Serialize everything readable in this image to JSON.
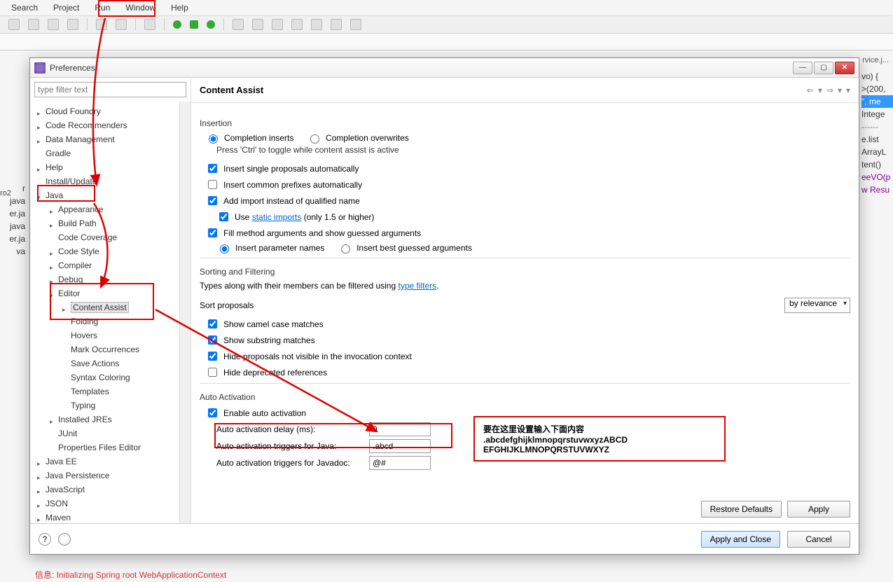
{
  "menubar": {
    "items": [
      "Search",
      "Project",
      "Run",
      "Window",
      "Help"
    ]
  },
  "dialog": {
    "title": "Preferences",
    "page_title": "Content Assist",
    "filter_placeholder": "type filter text"
  },
  "tree": [
    {
      "lvl": 0,
      "tw": "closed",
      "label": "Cloud Foundry"
    },
    {
      "lvl": 0,
      "tw": "closed",
      "label": "Code Recommenders"
    },
    {
      "lvl": 0,
      "tw": "closed",
      "label": "Data Management"
    },
    {
      "lvl": 0,
      "tw": "none",
      "label": "Gradle"
    },
    {
      "lvl": 0,
      "tw": "closed",
      "label": "Help"
    },
    {
      "lvl": 0,
      "tw": "none",
      "label": "Install/Update"
    },
    {
      "lvl": 0,
      "tw": "open",
      "label": "Java"
    },
    {
      "lvl": 1,
      "tw": "closed",
      "label": "Appearance"
    },
    {
      "lvl": 1,
      "tw": "closed",
      "label": "Build Path"
    },
    {
      "lvl": 1,
      "tw": "none",
      "label": "Code Coverage"
    },
    {
      "lvl": 1,
      "tw": "closed",
      "label": "Code Style"
    },
    {
      "lvl": 1,
      "tw": "closed",
      "label": "Compiler"
    },
    {
      "lvl": 1,
      "tw": "closed",
      "label": "Debug"
    },
    {
      "lvl": 1,
      "tw": "open",
      "label": "Editor"
    },
    {
      "lvl": 2,
      "tw": "closed",
      "label": "Content Assist",
      "sel": true
    },
    {
      "lvl": 2,
      "tw": "none",
      "label": "Folding"
    },
    {
      "lvl": 2,
      "tw": "none",
      "label": "Hovers"
    },
    {
      "lvl": 2,
      "tw": "none",
      "label": "Mark Occurrences"
    },
    {
      "lvl": 2,
      "tw": "none",
      "label": "Save Actions"
    },
    {
      "lvl": 2,
      "tw": "none",
      "label": "Syntax Coloring"
    },
    {
      "lvl": 2,
      "tw": "none",
      "label": "Templates"
    },
    {
      "lvl": 2,
      "tw": "none",
      "label": "Typing"
    },
    {
      "lvl": 1,
      "tw": "closed",
      "label": "Installed JREs"
    },
    {
      "lvl": 1,
      "tw": "none",
      "label": "JUnit"
    },
    {
      "lvl": 1,
      "tw": "none",
      "label": "Properties Files Editor"
    },
    {
      "lvl": 0,
      "tw": "closed",
      "label": "Java EE"
    },
    {
      "lvl": 0,
      "tw": "closed",
      "label": "Java Persistence"
    },
    {
      "lvl": 0,
      "tw": "closed",
      "label": "JavaScript"
    },
    {
      "lvl": 0,
      "tw": "closed",
      "label": "JSON"
    },
    {
      "lvl": 0,
      "tw": "closed",
      "label": "Maven"
    }
  ],
  "insertion": {
    "section": "Insertion",
    "completion_inserts": "Completion inserts",
    "completion_overwrites": "Completion overwrites",
    "toggle_hint": "Press 'Ctrl' to toggle while content assist is active",
    "insert_single": "Insert single proposals automatically",
    "insert_prefixes": "Insert common prefixes automatically",
    "add_import": "Add import instead of qualified name",
    "use_static_pre": "Use ",
    "use_static_link": "static imports",
    "use_static_post": " (only 1.5 or higher)",
    "fill_args": "Fill method arguments and show guessed arguments",
    "insert_param": "Insert parameter names",
    "insert_best": "Insert best guessed arguments"
  },
  "sorting": {
    "section": "Sorting and Filtering",
    "filter_hint_pre": "Types along with their members can be filtered using ",
    "filter_hint_link": "type filters",
    "sort_label": "Sort proposals",
    "sort_value": "by relevance",
    "camel": "Show camel case matches",
    "substring": "Show substring matches",
    "hide_invisible": "Hide proposals not visible in the invocation context",
    "hide_deprecated": "Hide deprecated references"
  },
  "auto": {
    "section": "Auto Activation",
    "enable": "Enable auto activation",
    "delay_label": "Auto activation delay (ms):",
    "delay_value": "0",
    "java_label": "Auto activation triggers for Java:",
    "java_value": ".abcd",
    "javadoc_label": "Auto activation triggers for Javadoc:",
    "javadoc_value": "@#"
  },
  "buttons": {
    "restore": "Restore Defaults",
    "apply": "Apply",
    "apply_close": "Apply and Close",
    "cancel": "Cancel"
  },
  "callout": {
    "line1": "要在这里设置输入下面内容",
    "line2": ".abcdefghijklmnopqrstuvwxyzABCD",
    "line3": "EFGHIJKLMNOPQRSTUVWXYZ"
  },
  "bg_left": [
    "r",
    "java",
    "er.ja",
    "java",
    "",
    "er.ja",
    "va"
  ],
  "bg_right": [
    "",
    "vo) {",
    "",
    ">(200,",
    "",
    "\", me",
    "",
    "Intege",
    "",
    "------",
    "e.list",
    "",
    "ArrayL",
    "tent()",
    "eeVO(p",
    "",
    "",
    "w Resu"
  ],
  "bg_top": "ro2",
  "bg_tab_right": "rvice.j...",
  "console": {
    "l1": "",
    "l2": "信息: Initializing Spring root WebApplicationContext"
  }
}
